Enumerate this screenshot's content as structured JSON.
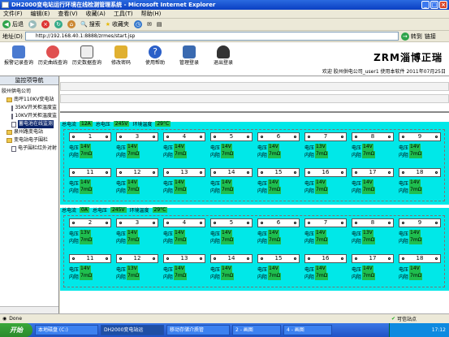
{
  "window": {
    "title": "DH2000变电站运行环境在线检测管理系统 - Microsoft Internet Explorer"
  },
  "menu": [
    "文件(F)",
    "编辑(E)",
    "查看(V)",
    "收藏(A)",
    "工具(T)",
    "帮助(H)"
  ],
  "toolbar": {
    "back": "后退",
    "search": "搜索",
    "favorites": "收藏夹"
  },
  "address": {
    "label": "地址(D)",
    "url": "http://192.168.40.1:8888/zrmes/start.jsp",
    "go": "转到",
    "links": "链接"
  },
  "header": {
    "nav": [
      "报警记录查询",
      "历史曲线查询",
      "历史数据查询",
      "修改密码",
      "使用帮助",
      "管理登录",
      "退出登录"
    ],
    "brand": "ZRM淄博正瑞",
    "welcome": "欢迎  胶州供电公司_user1 使用本软件    2011年07月25日"
  },
  "sidebar": {
    "title": "监控项导航",
    "tree": [
      {
        "label": "胶州供电公司",
        "level": 0,
        "type": "text"
      },
      {
        "label": "南坪110KV变电站",
        "level": 1,
        "type": "folder"
      },
      {
        "label": "35KV开关柜温度监",
        "level": 2,
        "type": "doc"
      },
      {
        "label": "10KV开关柜温度监",
        "level": 2,
        "type": "doc"
      },
      {
        "label": "蓄电池在线监测",
        "level": 2,
        "type": "doc",
        "selected": true
      },
      {
        "label": "泉州路变电站",
        "level": 1,
        "type": "folder"
      },
      {
        "label": "变电站电子围栏",
        "level": 1,
        "type": "folder"
      },
      {
        "label": "电子围栏红外对射",
        "level": 2,
        "type": "doc"
      }
    ]
  },
  "groups": [
    {
      "current_label": "总电流",
      "current": "12A",
      "voltage_label": "总电压",
      "voltage": "245V",
      "temp_label": "环境温度",
      "temp": "29°C",
      "cells": [
        {
          "n": "1",
          "v": "14V",
          "r": "7mΩ"
        },
        {
          "n": "3",
          "v": "14V",
          "r": "7mΩ"
        },
        {
          "n": "4",
          "v": "14V",
          "r": "7mΩ"
        },
        {
          "n": "5",
          "v": "14V",
          "r": "7mΩ"
        },
        {
          "n": "6",
          "v": "14V",
          "r": "7mΩ"
        },
        {
          "n": "7",
          "v": "13V",
          "r": "7mΩ"
        },
        {
          "n": "8",
          "v": "14V",
          "r": "7mΩ"
        },
        {
          "n": "9",
          "v": "14V",
          "r": "7mΩ"
        },
        {
          "n": "11",
          "v": "14V",
          "r": "7mΩ"
        },
        {
          "n": "12",
          "v": "14V",
          "r": "7mΩ"
        },
        {
          "n": "13",
          "v": "14V",
          "r": "7mΩ"
        },
        {
          "n": "14",
          "v": "14V",
          "r": "7mΩ"
        },
        {
          "n": "15",
          "v": "14V",
          "r": "7mΩ"
        },
        {
          "n": "16",
          "v": "14V",
          "r": "7mΩ"
        },
        {
          "n": "17",
          "v": "14V",
          "r": "7mΩ"
        },
        {
          "n": "18",
          "v": "14V",
          "r": "7mΩ"
        }
      ]
    },
    {
      "current_label": "总电流",
      "current": "0A",
      "voltage_label": "总电压",
      "voltage": "245V",
      "temp_label": "环境温度",
      "temp": "29°C",
      "cells": [
        {
          "n": "2",
          "v": "13V",
          "r": "7mΩ"
        },
        {
          "n": "3",
          "v": "14V",
          "r": "7mΩ"
        },
        {
          "n": "4",
          "v": "14V",
          "r": "7mΩ"
        },
        {
          "n": "5",
          "v": "14V",
          "r": "7mΩ"
        },
        {
          "n": "6",
          "v": "14V",
          "r": "7mΩ"
        },
        {
          "n": "7",
          "v": "14V",
          "r": "7mΩ"
        },
        {
          "n": "8",
          "v": "13V",
          "r": "7mΩ"
        },
        {
          "n": "9",
          "v": "14V",
          "r": "7mΩ"
        },
        {
          "n": "11",
          "v": "14V",
          "r": "7mΩ"
        },
        {
          "n": "12",
          "v": "13V",
          "r": "7mΩ"
        },
        {
          "n": "13",
          "v": "14V",
          "r": "7mΩ"
        },
        {
          "n": "14",
          "v": "14V",
          "r": "7mΩ"
        },
        {
          "n": "15",
          "v": "14V",
          "r": "7mΩ"
        },
        {
          "n": "16",
          "v": "14V",
          "r": "7mΩ"
        },
        {
          "n": "17",
          "v": "14V",
          "r": "7mΩ"
        },
        {
          "n": "18",
          "v": "14V",
          "r": "7mΩ"
        }
      ]
    }
  ],
  "cell_labels": {
    "voltage": "电压",
    "resistance": "内阻"
  },
  "status": {
    "left": "Done",
    "zone": "可信站点"
  },
  "taskbar": {
    "start": "开始",
    "tasks": [
      "本地磁盘 (C:)",
      "DH2000变电站运",
      "移动存储介质管",
      "2 - 画图",
      "4 - 画图"
    ],
    "clock": "17:12"
  }
}
